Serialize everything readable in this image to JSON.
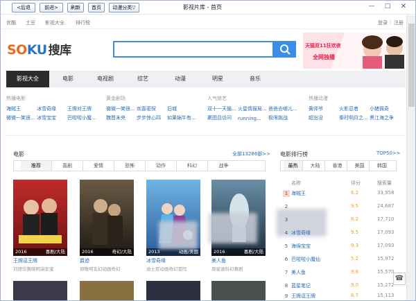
{
  "toolbar": {
    "back": "<后退",
    "forward": "前进>",
    "refresh": "刷新",
    "home": "首页",
    "anime_category": "动漫分类▽"
  },
  "window": {
    "title": "影视片库 - 首页"
  },
  "topnav": {
    "left": [
      "优酷",
      "土豆",
      "影视大全",
      "排行榜"
    ],
    "login": "登录",
    "sep": "|",
    "register": "注册"
  },
  "logo": {
    "part1": "SO",
    "part2": "KU",
    "part3": "搜库"
  },
  "search": {
    "placeholder": ""
  },
  "ad": {
    "line1": "天猫双11狂欢夜",
    "line2": "全网独播"
  },
  "categories": {
    "items": [
      "影视大全",
      "电影",
      "电视剧",
      "综艺",
      "动漫",
      "明星",
      "音乐"
    ],
    "active": "影视大全"
  },
  "hot_lists": [
    {
      "title": "热播电影",
      "rows": [
        [
          "海贼王",
          "冰雪奇缘",
          "王牌对王牌"
        ],
        [
          "微微一笑很...",
          "冰雪宝宝",
          "巴啦啦小魔..."
        ]
      ]
    },
    {
      "title": "黄金剧场",
      "rows": [
        [
          "微微一笑很...",
          "欢喜密探",
          "旧城"
        ],
        [
          "魏晋未央",
          "步步惊心四",
          "如果蜗牛有..."
        ]
      ]
    },
    {
      "title": "人气综艺",
      "rows": [
        [
          "双十一天猫...",
          "火星情报局...",
          "爸爸去哪儿..."
        ],
        [
          "裹图且访问",
          "running...",
          "极限挑战"
        ]
      ]
    },
    {
      "title": "热播动漫",
      "rows": [
        [
          "黄师爷",
          "火影忍者",
          "小猪佩奇"
        ],
        [
          "超出没",
          "秦时明月之...",
          "黑江海之争"
        ]
      ]
    }
  ],
  "movies": {
    "title": "电影",
    "all_link": "全部13286部>>",
    "filters": [
      "推荐",
      "喜剧",
      "爱情",
      "恐怖",
      "动作",
      "科幻",
      "战争"
    ],
    "active_filter": "推荐",
    "items": [
      {
        "title": "王牌逗王牌",
        "sub": "刘德华黄晓明演安宝",
        "year": "2016",
        "region": "喜剧/大陆"
      },
      {
        "title": "爵迹",
        "sub": "郭敬明玄幻动画奇幻",
        "year": "2016",
        "region": "奇幻/大陆"
      },
      {
        "title": "冰雪奇缘",
        "sub": "迪士尼动画奇幻冒险",
        "year": "2013",
        "region": "动画/美国"
      },
      {
        "title": "美人鱼",
        "sub": "周星驰科幻喜剧",
        "year": "2016",
        "region": "喜剧/大陆"
      }
    ]
  },
  "ranking": {
    "title": "电影排行榜",
    "more": "TOP50>>",
    "tabs": [
      "最热",
      "大陆",
      "香港",
      "美国",
      "韩国"
    ],
    "active_tab": "最热",
    "headers": [
      "名称",
      "评分",
      "搜索量"
    ],
    "rows": [
      {
        "n": "1",
        "t": "海贼王",
        "s": "6.2",
        "v": "33,958"
      },
      {
        "n": "2",
        "t": "",
        "s": "9.5",
        "v": "24,687"
      },
      {
        "n": "3",
        "t": "",
        "s": "8.2",
        "v": "17,710"
      },
      {
        "n": "4",
        "t": "冰雪奇缘",
        "s": "9.5",
        "v": "17,093"
      },
      {
        "n": "5",
        "t": "海绵宝宝",
        "s": "9.3",
        "v": "17,093"
      },
      {
        "n": "6",
        "t": "巴啦啦小魔仙",
        "s": "5.2",
        "v": "15,972"
      },
      {
        "n": "7",
        "t": "美人鱼",
        "s": "9.6",
        "v": "15,570"
      },
      {
        "n": "8",
        "t": "蓝星笔记",
        "s": "9.0",
        "v": "15,272"
      },
      {
        "n": "9",
        "t": "王牌逗王牌",
        "s": "8.7",
        "v": "15,113"
      }
    ]
  },
  "help_icon": "help"
}
